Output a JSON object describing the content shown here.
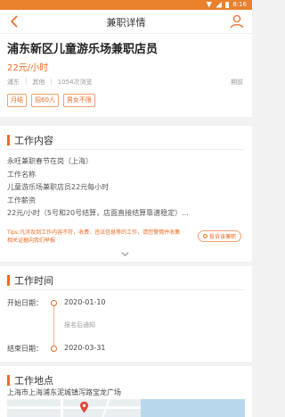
{
  "status_bar": {
    "time": "8:16"
  },
  "header": {
    "title": "兼职详情"
  },
  "job": {
    "title": "浦东新区儿童游乐场兼职店员",
    "salary": "22元/小时",
    "district": "浦东",
    "category": "其他",
    "views": "1054次浏览",
    "region_tag": "期前",
    "tags": [
      "月结",
      "招60人",
      "男女不限"
    ]
  },
  "work_content": {
    "section_title": "工作内容",
    "lines": [
      "永旺兼职春节在岗（上海）",
      "工作名称",
      "儿童游乐场兼职店员22元每小时",
      "工作薪资",
      "22元/小时（5号和20号结算，店面直接结算靠谱稳定）..."
    ],
    "tips": "Tips:凡涉及到工作内容不符，收费、违法信息等的工作，请您警惕并收集相关证据向我们举报",
    "report_label": "投诉该兼职"
  },
  "work_time": {
    "section_title": "工作时间",
    "start_label": "开始日期：",
    "start_date": "2020-01-10",
    "note": "报名后通知",
    "end_label": "结束日期：",
    "end_date": "2020-03-31"
  },
  "work_location": {
    "section_title": "工作地点",
    "address": "上海市上海浦东泥城镇泻路宝龙广场"
  },
  "colors": {
    "accent": "#ee6a20",
    "status_bar": "#e8802c"
  }
}
